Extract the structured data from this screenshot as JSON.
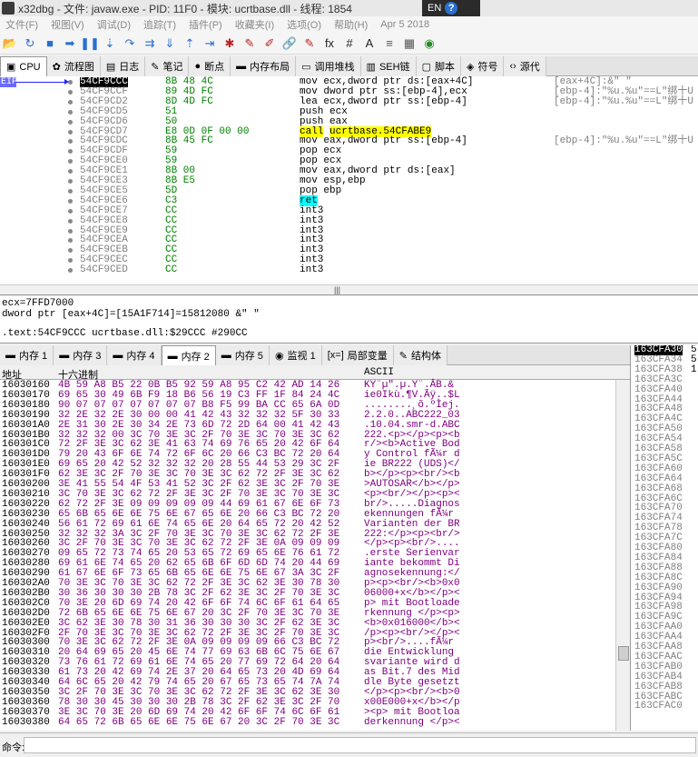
{
  "window": {
    "title": "x32dbg - 文件: javaw.exe - PID: 11F0 - 模块: ucrtbase.dll - 线程: 1854",
    "lang": "EN",
    "help": "?"
  },
  "menu": [
    "文件(F)",
    "视图(V)",
    "调试(D)",
    "追踪(T)",
    "插件(P)",
    "收藏夹(I)",
    "选项(O)",
    "帮助(H)",
    "Apr 5 2018"
  ],
  "toolbar": [
    {
      "icon": "open-folder-icon",
      "glyph": "📂",
      "cls": "blk"
    },
    {
      "icon": "restart-icon",
      "glyph": "↻",
      "cls": ""
    },
    {
      "icon": "stop-icon",
      "glyph": "■",
      "cls": ""
    },
    {
      "icon": "run-icon",
      "glyph": "➡",
      "cls": ""
    },
    {
      "icon": "pause-icon",
      "glyph": "❚❚",
      "cls": ""
    },
    {
      "icon": "step-into-icon",
      "glyph": "⇣",
      "cls": ""
    },
    {
      "icon": "step-over-icon",
      "glyph": "↷",
      "cls": ""
    },
    {
      "icon": "trace-into-icon",
      "glyph": "⇉",
      "cls": ""
    },
    {
      "icon": "trace-over-icon",
      "glyph": "⇓",
      "cls": ""
    },
    {
      "icon": "execute-till-return-icon",
      "glyph": "⇡",
      "cls": ""
    },
    {
      "icon": "run-to-user-code-icon",
      "glyph": "⇥",
      "cls": ""
    },
    {
      "icon": "script-icon",
      "glyph": "✱",
      "cls": "red"
    },
    {
      "icon": "patch-icon",
      "glyph": "✎",
      "cls": "red"
    },
    {
      "icon": "comment-icon",
      "glyph": "✐",
      "cls": "red"
    },
    {
      "icon": "label-icon",
      "glyph": "🔗",
      "cls": "gry"
    },
    {
      "icon": "bookmark-icon",
      "glyph": "✎",
      "cls": "red"
    },
    {
      "icon": "function-icon",
      "glyph": "fx",
      "cls": "blk"
    },
    {
      "icon": "hash-icon",
      "glyph": "#",
      "cls": "blk"
    },
    {
      "icon": "font-icon",
      "glyph": "A",
      "cls": "blk"
    },
    {
      "icon": "strings-icon",
      "glyph": "≡",
      "cls": "gry"
    },
    {
      "icon": "calculator-icon",
      "glyph": "▦",
      "cls": "gry"
    },
    {
      "icon": "globe-icon",
      "glyph": "◉",
      "cls": "grn"
    }
  ],
  "main_tabs": [
    {
      "label": "CPU",
      "icon": "cpu-icon",
      "glyph": "▣",
      "active": true
    },
    {
      "label": "流程图",
      "icon": "graph-icon",
      "glyph": "✿"
    },
    {
      "label": "日志",
      "icon": "log-icon",
      "glyph": "▤"
    },
    {
      "label": "笔记",
      "icon": "notes-icon",
      "glyph": "✎"
    },
    {
      "label": "断点",
      "icon": "breakpoint-icon",
      "glyph": "●"
    },
    {
      "label": "内存布局",
      "icon": "memory-map-icon",
      "glyph": "▬"
    },
    {
      "label": "调用堆栈",
      "icon": "call-stack-icon",
      "glyph": "▭"
    },
    {
      "label": "SEH链",
      "icon": "seh-icon",
      "glyph": "▥"
    },
    {
      "label": "脚本",
      "icon": "script-tab-icon",
      "glyph": "▢"
    },
    {
      "label": "符号",
      "icon": "symbols-icon",
      "glyph": "◈"
    },
    {
      "label": "源代",
      "icon": "source-icon",
      "glyph": "‹›"
    }
  ],
  "cpu": {
    "eip_label": "EIP",
    "rows": [
      {
        "addr": "54CF9CCC",
        "bytes": "8B 48 4C",
        "mnem": "mov",
        "ops": "ecx,dword ptr ds:[eax+4C]",
        "cmt": "[eax+4C]:&\" \"",
        "sel": true
      },
      {
        "addr": "54CF9CCF",
        "bytes": "89 4D FC",
        "mnem": "mov",
        "ops": "dword ptr ss:[ebp-4],ecx",
        "cmt": "[ebp-4]:\"%u.%u\"==L\"绑十U"
      },
      {
        "addr": "54CF9CD2",
        "bytes": "8D 4D FC",
        "mnem": "lea",
        "ops": "ecx,dword ptr ss:[ebp-4]",
        "cmt": "[ebp-4]:\"%u.%u\"==L\"绑十U"
      },
      {
        "addr": "54CF9CD5",
        "bytes": "51",
        "mnem": "push",
        "ops": "ecx",
        "cmt": ""
      },
      {
        "addr": "54CF9CD6",
        "bytes": "50",
        "mnem": "push",
        "ops": "eax",
        "cmt": ""
      },
      {
        "addr": "54CF9CD7",
        "bytes": "E8 0D 0F 00 00",
        "mnem": "call",
        "ops": "ucrtbase.54CFABE9",
        "cmt": "",
        "kind": "call"
      },
      {
        "addr": "54CF9CDC",
        "bytes": "8B 45 FC",
        "mnem": "mov",
        "ops": "eax,dword ptr ss:[ebp-4]",
        "cmt": "[ebp-4]:\"%u.%u\"==L\"绑十U"
      },
      {
        "addr": "54CF9CDF",
        "bytes": "59",
        "mnem": "pop",
        "ops": "ecx",
        "cmt": ""
      },
      {
        "addr": "54CF9CE0",
        "bytes": "59",
        "mnem": "pop",
        "ops": "ecx",
        "cmt": ""
      },
      {
        "addr": "54CF9CE1",
        "bytes": "8B 00",
        "mnem": "mov",
        "ops": "eax,dword ptr ds:[eax]",
        "cmt": ""
      },
      {
        "addr": "54CF9CE3",
        "bytes": "8B E5",
        "mnem": "mov",
        "ops": "esp,ebp",
        "cmt": ""
      },
      {
        "addr": "54CF9CE5",
        "bytes": "5D",
        "mnem": "pop",
        "ops": "ebp",
        "cmt": ""
      },
      {
        "addr": "54CF9CE6",
        "bytes": "C3",
        "mnem": "ret",
        "ops": "",
        "cmt": "",
        "kind": "ret"
      },
      {
        "addr": "54CF9CE7",
        "bytes": "CC",
        "mnem": "int3",
        "ops": "",
        "cmt": ""
      },
      {
        "addr": "54CF9CE8",
        "bytes": "CC",
        "mnem": "int3",
        "ops": "",
        "cmt": ""
      },
      {
        "addr": "54CF9CE9",
        "bytes": "CC",
        "mnem": "int3",
        "ops": "",
        "cmt": ""
      },
      {
        "addr": "54CF9CEA",
        "bytes": "CC",
        "mnem": "int3",
        "ops": "",
        "cmt": ""
      },
      {
        "addr": "54CF9CEB",
        "bytes": "CC",
        "mnem": "int3",
        "ops": "",
        "cmt": ""
      },
      {
        "addr": "54CF9CEC",
        "bytes": "CC",
        "mnem": "int3",
        "ops": "",
        "cmt": ""
      },
      {
        "addr": "54CF9CED",
        "bytes": "CC",
        "mnem": "int3",
        "ops": "",
        "cmt": ""
      }
    ]
  },
  "info": {
    "line1": "ecx=7FFD7000",
    "line2": "dword ptr [eax+4C]=[15A1F714]=15812080 &\" \"",
    "line3": ".text:54CF9CCC ucrtbase.dll:$29CCC #290CC"
  },
  "dump_tabs": [
    {
      "label": "内存 1",
      "icon": "memory-icon",
      "glyph": "▬"
    },
    {
      "label": "内存 3",
      "icon": "memory-icon",
      "glyph": "▬"
    },
    {
      "label": "内存 4",
      "icon": "memory-icon",
      "glyph": "▬"
    },
    {
      "label": "内存 2",
      "icon": "memory-icon",
      "glyph": "▬",
      "active": true
    },
    {
      "label": "内存 5",
      "icon": "memory-icon",
      "glyph": "▬"
    },
    {
      "label": "监视 1",
      "icon": "watch-icon",
      "glyph": "◉"
    },
    {
      "label": "局部变量",
      "icon": "locals-icon",
      "glyph": "[x=]"
    },
    {
      "label": "结构体",
      "icon": "struct-icon",
      "glyph": "✎"
    }
  ],
  "dump": {
    "col_addr": "地址",
    "col_hex": "十六进制",
    "col_ascii": "ASCII",
    "rows": [
      {
        "addr": "16030160",
        "hex": "4B 59 A8 B5 22 0B B5 92 59 A8 95 C2 42 AD 14 26",
        "ascii": "KY¨µ\".µ.Y¨.ÂB.&"
      },
      {
        "addr": "16030170",
        "hex": "69 65 30 49 6B F9 18 B6 56 19 C3 FF 1F 84 24 4C",
        "ascii": "ie0Ikù.¶V.Ãÿ..$L"
      },
      {
        "addr": "16030180",
        "hex": "90 07 07 07 07 07 07 07 B8 F5 99 BA CC 65 6A 0D",
        "ascii": "........¸õ.ºÌej."
      },
      {
        "addr": "16030190",
        "hex": "32 2E 32 2E 30 00 00 41 42 43 32 32 32 5F 30 33",
        "ascii": "2.2.0..ABC222_03"
      },
      {
        "addr": "160301A0",
        "hex": "2E 31 30 2E 30 34 2E 73 6D 72 2D 64 00 41 42 43",
        "ascii": ".10.04.smr-d.ABC"
      },
      {
        "addr": "160301B0",
        "hex": "32 32 32 00 3C 70 3E 3C 2F 70 3E 3C 70 3E 3C 62",
        "ascii": "222.<p></p><p><b"
      },
      {
        "addr": "160301C0",
        "hex": "72 2F 3E 3C 62 3E 41 63 74 69 76 65 20 42 6F 64",
        "ascii": "r/><b>Active Bod"
      },
      {
        "addr": "160301D0",
        "hex": "79 20 43 6F 6E 74 72 6F 6C 20 66 C3 BC 72 20 64",
        "ascii": "y Control fÃ¼r d"
      },
      {
        "addr": "160301E0",
        "hex": "69 65 20 42 52 32 32 32 20 28 55 44 53 29 3C 2F",
        "ascii": "ie BR222 (UDS)</"
      },
      {
        "addr": "160301F0",
        "hex": "62 3E 3C 2F 70 3E 3C 70 3E 3C 62 72 2F 3E 3C 62",
        "ascii": "b></p><p><br/><b"
      },
      {
        "addr": "16030200",
        "hex": "3E 41 55 54 4F 53 41 52 3C 2F 62 3E 3C 2F 70 3E",
        "ascii": ">AUTOSAR</b></p>"
      },
      {
        "addr": "16030210",
        "hex": "3C 70 3E 3C 62 72 2F 3E 3C 2F 70 3E 3C 70 3E 3C",
        "ascii": "<p><br/></p><p><"
      },
      {
        "addr": "16030220",
        "hex": "62 72 2F 3E 09 09 09 09 09 44 69 61 67 6E 6F 73",
        "ascii": "br/>.....Diagnos"
      },
      {
        "addr": "16030230",
        "hex": "65 6B 65 6E 6E 75 6E 67 65 6E 20 66 C3 BC 72 20",
        "ascii": "ekennungen fÃ¼r "
      },
      {
        "addr": "16030240",
        "hex": "56 61 72 69 61 6E 74 65 6E 20 64 65 72 20 42 52",
        "ascii": "Varianten der BR"
      },
      {
        "addr": "16030250",
        "hex": "32 32 32 3A 3C 2F 70 3E 3C 70 3E 3C 62 72 2F 3E",
        "ascii": "222:</p><p><br/>"
      },
      {
        "addr": "16030260",
        "hex": "3C 2F 70 3E 3C 70 3E 3C 62 72 2F 3E 0A 09 09 09",
        "ascii": "</p><p><br/>...."
      },
      {
        "addr": "16030270",
        "hex": "09 65 72 73 74 65 20 53 65 72 69 65 6E 76 61 72",
        "ascii": ".erste Serienvar"
      },
      {
        "addr": "16030280",
        "hex": "69 61 6E 74 65 20 62 65 6B 6F 6D 6D 74 20 44 69",
        "ascii": "iante bekommt Di"
      },
      {
        "addr": "16030290",
        "hex": "61 67 6E 6F 73 65 6B 65 6E 6E 75 6E 67 3A 3C 2F",
        "ascii": "agnosekennung:</"
      },
      {
        "addr": "160302A0",
        "hex": "70 3E 3C 70 3E 3C 62 72 2F 3E 3C 62 3E 30 78 30",
        "ascii": "p><p><br/><b>0x0"
      },
      {
        "addr": "160302B0",
        "hex": "30 36 30 30 30 2B 78 3C 2F 62 3E 3C 2F 70 3E 3C",
        "ascii": "06000+x</b></p><"
      },
      {
        "addr": "160302C0",
        "hex": "70 3E 20 6D 69 74 20 42 6F 6F 74 6C 6F 61 64 65",
        "ascii": "p> mit Bootloade"
      },
      {
        "addr": "160302D0",
        "hex": "72 6B 65 6E 6E 75 6E 67 20 3C 2F 70 3E 3C 70 3E",
        "ascii": "rkennung </p><p>"
      },
      {
        "addr": "160302E0",
        "hex": "3C 62 3E 30 78 30 31 36 30 30 30 3C 2F 62 3E 3C",
        "ascii": "<b>0x016000</b><"
      },
      {
        "addr": "160302F0",
        "hex": "2F 70 3E 3C 70 3E 3C 62 72 2F 3E 3C 2F 70 3E 3C",
        "ascii": "/p><p><br/></p><"
      },
      {
        "addr": "16030300",
        "hex": "70 3E 3C 62 72 2F 3E 0A 09 09 09 09 66 C3 BC 72",
        "ascii": "p><br/>....fÃ¼r"
      },
      {
        "addr": "16030310",
        "hex": "20 64 69 65 20 45 6E 74 77 69 63 6B 6C 75 6E 67",
        "ascii": " die Entwicklung"
      },
      {
        "addr": "16030320",
        "hex": "73 76 61 72 69 61 6E 74 65 20 77 69 72 64 20 64",
        "ascii": "svariante wird d"
      },
      {
        "addr": "16030330",
        "hex": "61 73 20 42 69 74 2E 37 20 64 65 73 20 4D 69 64",
        "ascii": "as Bit.7 des Mid"
      },
      {
        "addr": "16030340",
        "hex": "64 6C 65 20 42 79 74 65 20 67 65 73 65 74 7A 74",
        "ascii": "dle Byte gesetzt"
      },
      {
        "addr": "16030350",
        "hex": "3C 2F 70 3E 3C 70 3E 3C 62 72 2F 3E 3C 62 3E 30",
        "ascii": "</p><p><br/><b>0"
      },
      {
        "addr": "16030360",
        "hex": "78 30 30 45 30 30 30 2B 78 3C 2F 62 3E 3C 2F 70",
        "ascii": "x00E000+x</b></p"
      },
      {
        "addr": "16030370",
        "hex": "3E 3C 70 3E 20 6D 69 74 20 42 6F 6F 74 6C 6F 61",
        "ascii": "><p> mit Bootloa"
      },
      {
        "addr": "16030380",
        "hex": "64 65 72 6B 65 6E 6E 75 6E 67 20 3C 2F 70 3E 3C",
        "ascii": "derkennung </p><"
      }
    ]
  },
  "stack": {
    "rows": [
      {
        "addr": "163CFA30",
        "val": "5",
        "sel": true
      },
      {
        "addr": "163CFA34",
        "val": "5"
      },
      {
        "addr": "163CFA38",
        "val": "1"
      },
      {
        "addr": "163CFA3C",
        "val": ""
      },
      {
        "addr": "163CFA40",
        "val": ""
      },
      {
        "addr": "163CFA44",
        "val": ""
      },
      {
        "addr": "163CFA48",
        "val": ""
      },
      {
        "addr": "163CFA4C",
        "val": ""
      },
      {
        "addr": "163CFA50",
        "val": ""
      },
      {
        "addr": "163CFA54",
        "val": ""
      },
      {
        "addr": "163CFA58",
        "val": ""
      },
      {
        "addr": "163CFA5C",
        "val": ""
      },
      {
        "addr": "163CFA60",
        "val": ""
      },
      {
        "addr": "163CFA64",
        "val": ""
      },
      {
        "addr": "163CFA68",
        "val": ""
      },
      {
        "addr": "163CFA6C",
        "val": ""
      },
      {
        "addr": "163CFA70",
        "val": ""
      },
      {
        "addr": "163CFA74",
        "val": ""
      },
      {
        "addr": "163CFA78",
        "val": ""
      },
      {
        "addr": "163CFA7C",
        "val": ""
      },
      {
        "addr": "163CFA80",
        "val": ""
      },
      {
        "addr": "163CFA84",
        "val": ""
      },
      {
        "addr": "163CFA88",
        "val": ""
      },
      {
        "addr": "163CFA8C",
        "val": ""
      },
      {
        "addr": "163CFA90",
        "val": ""
      },
      {
        "addr": "163CFA94",
        "val": ""
      },
      {
        "addr": "163CFA98",
        "val": ""
      },
      {
        "addr": "163CFA9C",
        "val": ""
      },
      {
        "addr": "163CFAA0",
        "val": ""
      },
      {
        "addr": "163CFAA4",
        "val": ""
      },
      {
        "addr": "163CFAA8",
        "val": ""
      },
      {
        "addr": "163CFAAC",
        "val": ""
      },
      {
        "addr": "163CFAB0",
        "val": ""
      },
      {
        "addr": "163CFAB4",
        "val": ""
      },
      {
        "addr": "163CFAB8",
        "val": ""
      },
      {
        "addr": "163CFABC",
        "val": ""
      },
      {
        "addr": "163CFAC0",
        "val": ""
      }
    ]
  },
  "command": {
    "label": "命令:",
    "value": ""
  }
}
